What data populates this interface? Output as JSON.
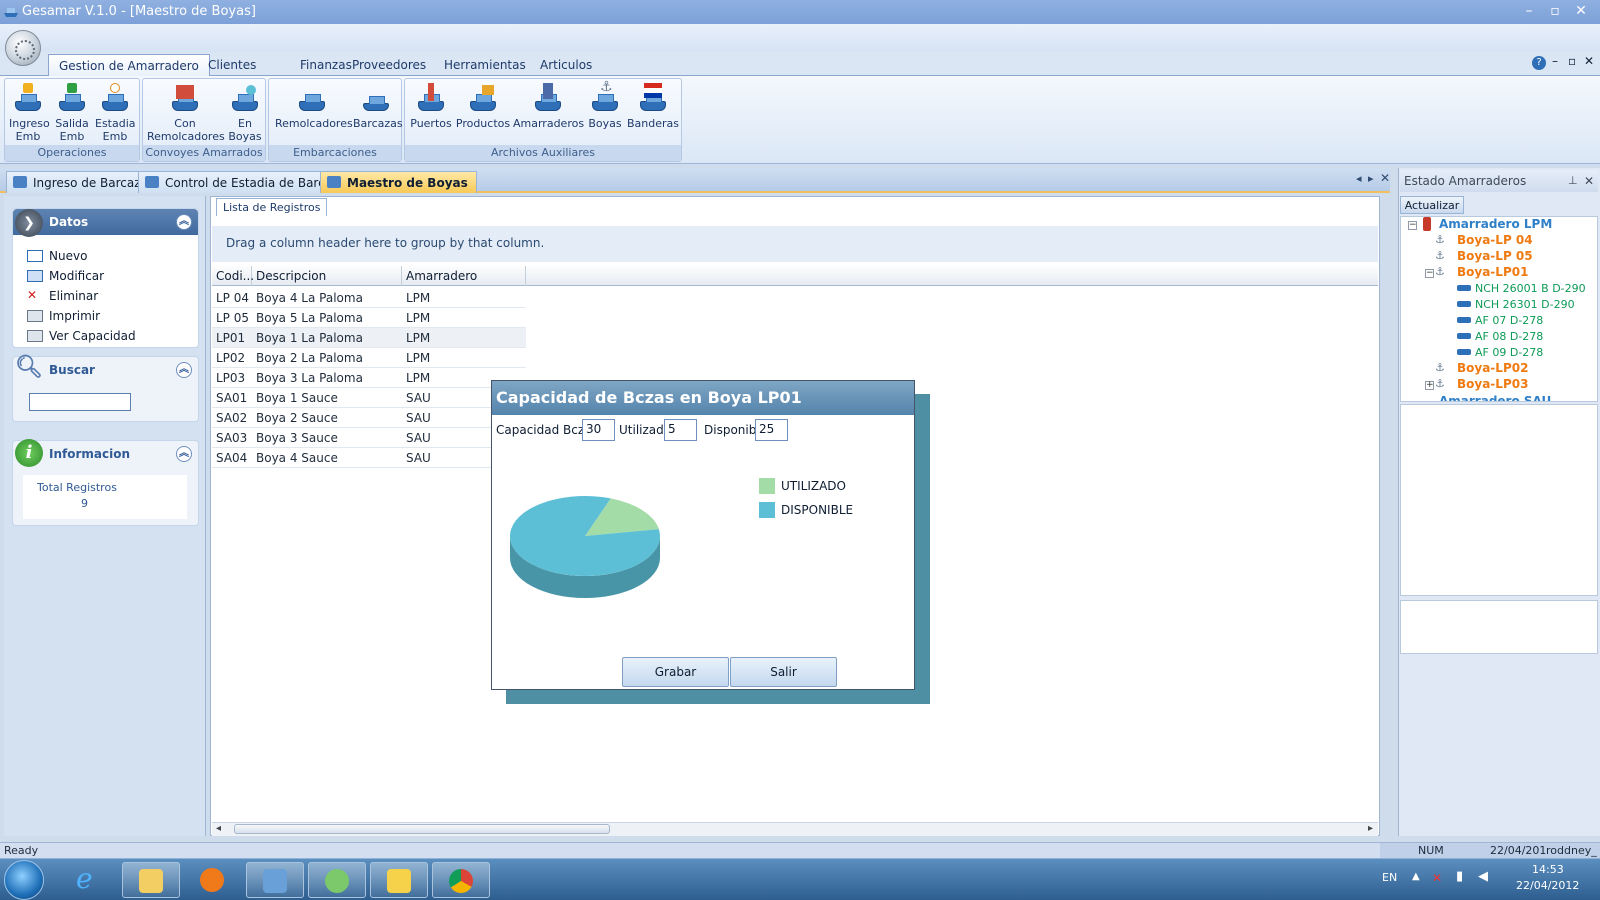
{
  "window": {
    "title": "Gesamar V.1.0 - [Maestro de Boyas]"
  },
  "ribbon_tabs": [
    "Gestion de Amarradero",
    "Clientes",
    "Finanzas",
    "Proveedores",
    "Herramientas",
    "Articulos"
  ],
  "ribbon_groups": [
    {
      "caption": "Operaciones",
      "buttons": [
        {
          "l1": "Ingreso",
          "l2": "Emb"
        },
        {
          "l1": "Salida",
          "l2": "Emb"
        },
        {
          "l1": "Estadia",
          "l2": "Emb"
        }
      ]
    },
    {
      "caption": "Convoyes Amarrados",
      "buttons": [
        {
          "l1": "Con",
          "l2": "Remolcadores"
        },
        {
          "l1": "En",
          "l2": "Boyas"
        }
      ]
    },
    {
      "caption": "Embarcaciones",
      "buttons": [
        {
          "l1": "Remolcadores",
          "l2": ""
        },
        {
          "l1": "Barcazas",
          "l2": ""
        }
      ]
    },
    {
      "caption": "Archivos Auxiliares",
      "buttons": [
        {
          "l1": "Puertos",
          "l2": ""
        },
        {
          "l1": "Productos",
          "l2": ""
        },
        {
          "l1": "Amarraderos",
          "l2": ""
        },
        {
          "l1": "Boyas",
          "l2": ""
        },
        {
          "l1": "Banderas",
          "l2": ""
        }
      ]
    }
  ],
  "doc_tabs": [
    "Ingreso de Barcazas",
    "Control de Estadia de Barcazas",
    "Maestro de Boyas"
  ],
  "left_panel": {
    "datos": {
      "title": "Datos",
      "items": [
        "Nuevo",
        "Modificar",
        "Eliminar",
        "Imprimir",
        "Ver Capacidad"
      ]
    },
    "buscar": {
      "title": "Buscar",
      "value": ""
    },
    "informacion": {
      "title": "Informacion",
      "label": "Total Registros",
      "value": "9"
    }
  },
  "subtab": "Lista de Registros",
  "group_hint": "Drag a column header here to group by that column.",
  "grid": {
    "columns": [
      "Codi...",
      "Descripcion",
      "Amarradero"
    ],
    "rows": [
      [
        "LP 04",
        "Boya 4 La Paloma",
        "LPM"
      ],
      [
        "LP 05",
        "Boya 5 La Paloma",
        "LPM"
      ],
      [
        "LP01",
        "Boya 1 La Paloma",
        "LPM"
      ],
      [
        "LP02",
        "Boya 2 La Paloma",
        "LPM"
      ],
      [
        "LP03",
        "Boya 3 La Paloma",
        "LPM"
      ],
      [
        "SA01",
        "Boya 1 Sauce",
        "SAU"
      ],
      [
        "SA02",
        "Boya 2 Sauce",
        "SAU"
      ],
      [
        "SA03",
        "Boya 3 Sauce",
        "SAU"
      ],
      [
        "SA04",
        "Boya 4 Sauce",
        "SAU"
      ]
    ]
  },
  "right_panel": {
    "title": "Estado Amarraderos",
    "button": "Actualizar",
    "tree": {
      "root": "Amarradero LPM",
      "boyas": [
        "Boya-LP 04",
        "Boya-LP 05",
        "Boya-LP01",
        "Boya-LP02",
        "Boya-LP03"
      ],
      "lp01_children": [
        "NCH 26001 B D-290",
        "NCH 26301 D-290",
        "AF 07 D-278",
        "AF 08 D-278",
        "AF 09 D-278"
      ],
      "next_root": "Amarradero SAU"
    }
  },
  "dialog": {
    "title": "Capacidad de Bczas en Boya LP01",
    "cap_label": "Capacidad Bczas",
    "cap_value": "30",
    "util_label": "Utilizado",
    "util_value": "5",
    "disp_label": "Disponible",
    "disp_value": "25",
    "save_button": "Grabar",
    "exit_button": "Salir"
  },
  "chart_data": {
    "type": "pie",
    "categories": [
      "UTILIZADO",
      "DISPONIBLE"
    ],
    "values": [
      5,
      25
    ],
    "colors": [
      "#a4dca8",
      "#5cbfd6"
    ],
    "legend": "right"
  },
  "status": {
    "left": "Ready",
    "num": "NUM",
    "date": "22/04/201",
    "user": "roddney_"
  },
  "taskbar": {
    "lang": "EN",
    "time": "14:53",
    "date": "22/04/2012"
  }
}
